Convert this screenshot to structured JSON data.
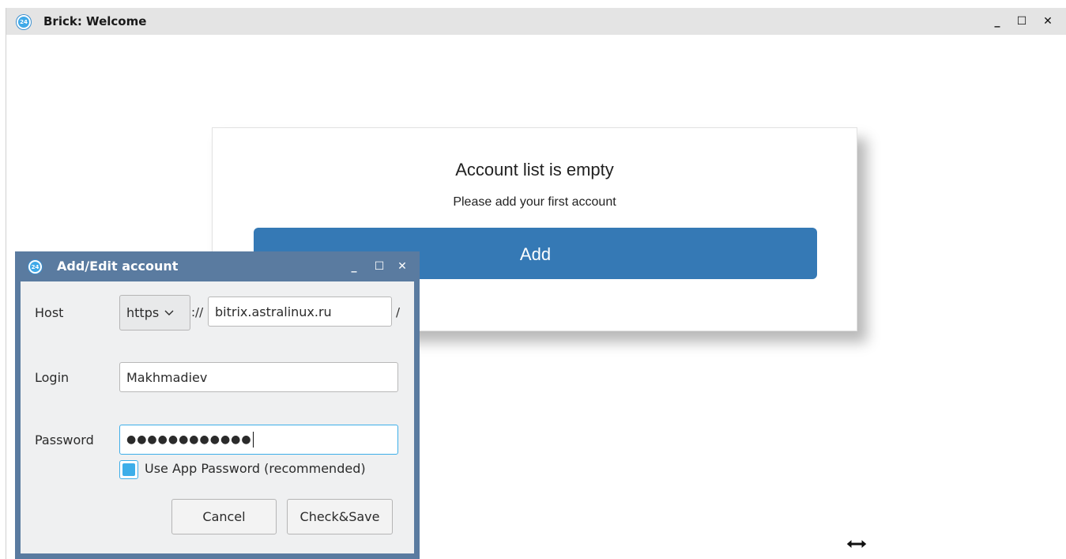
{
  "main_window": {
    "icon_text": "24",
    "title": "Brick: Welcome",
    "controls": {
      "minimize": "_",
      "maximize": "☐",
      "close": "✕"
    }
  },
  "card": {
    "title": "Account list is empty",
    "subtitle": "Please add your first account",
    "add_button": "Add"
  },
  "dialog": {
    "icon_text": "24",
    "title": "Add/Edit account",
    "controls": {
      "minimize": "_",
      "maximize": "☐",
      "close": "✕"
    },
    "host": {
      "label": "Host",
      "scheme": "https",
      "separator": "://",
      "value": "bitrix.astralinux.ru",
      "suffix": "/"
    },
    "login": {
      "label": "Login",
      "value": "Makhmadiev"
    },
    "password": {
      "label": "Password",
      "masked_value": "●●●●●●●●●●●●"
    },
    "app_password_checkbox": {
      "label": "Use App Password (recommended)",
      "checked": true
    },
    "buttons": {
      "cancel": "Cancel",
      "check_save": "Check&Save"
    }
  },
  "colors": {
    "accent": "#3daee9",
    "add_button": "#3579b5",
    "dialog_frame": "#5a7ba0"
  },
  "icons": {
    "cursor": "horizontal-resize-cursor-icon"
  }
}
